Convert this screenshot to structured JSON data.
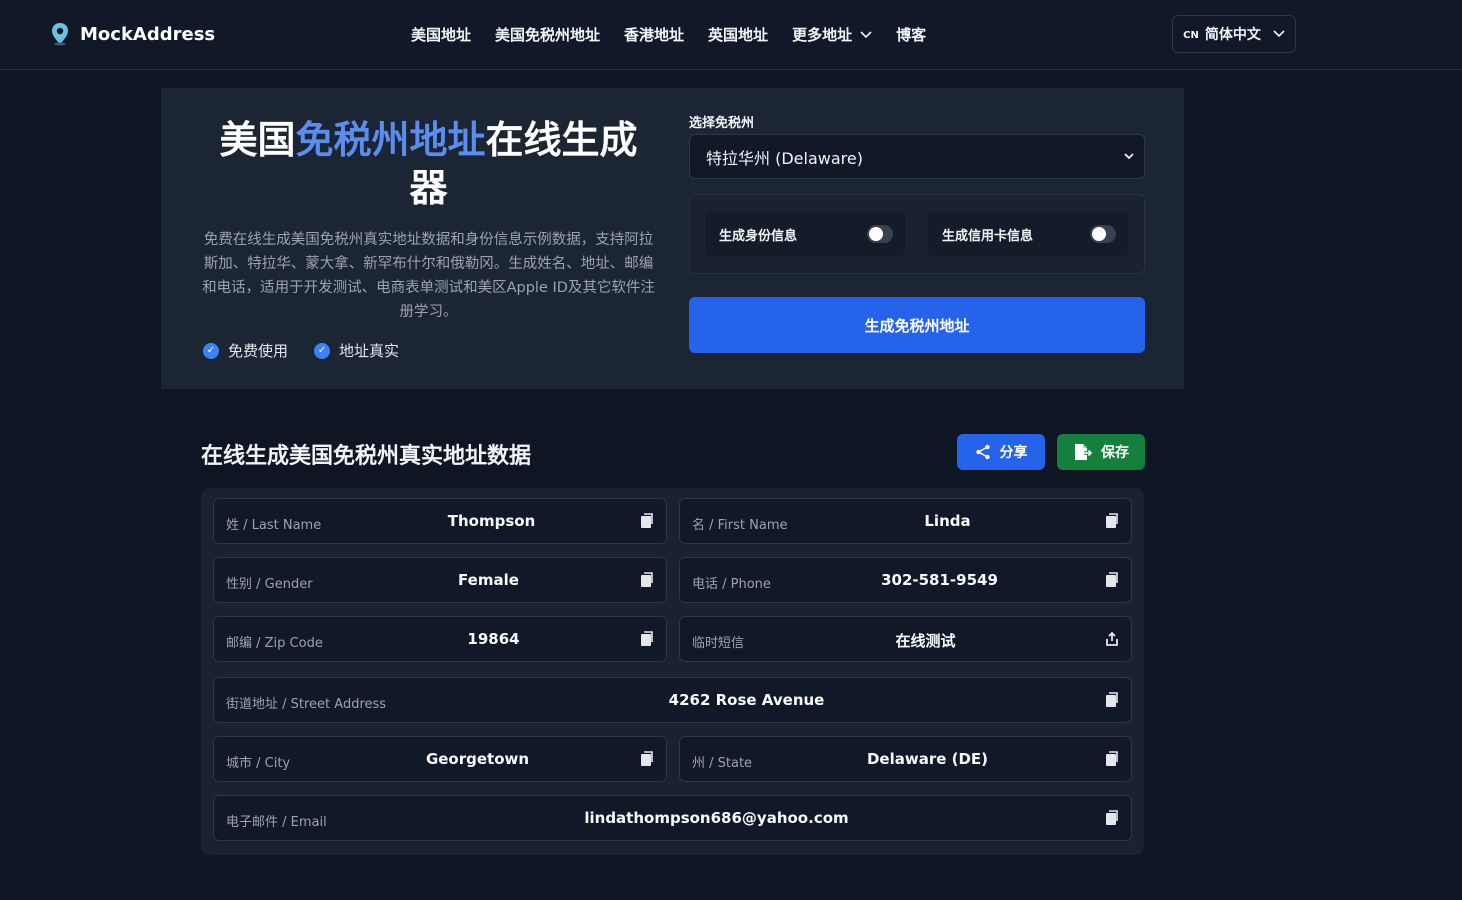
{
  "nav": {
    "brand": "MockAddress",
    "links": [
      "美国地址",
      "美国免税州地址",
      "香港地址",
      "英国地址",
      "更多地址",
      "博客"
    ],
    "lang_code": "CN",
    "lang_label": "简体中文"
  },
  "hero": {
    "title_prefix": "美国",
    "title_accent": "免税州地址",
    "title_suffix": "在线生成器",
    "description": "免费在线生成美国免税州真实地址数据和身份信息示例数据，支持阿拉斯加、特拉华、蒙大拿、新罕布什尔和俄勒冈。生成姓名、地址、邮编和电话，适用于开发测试、电商表单测试和美区Apple ID及其它软件注册学习。",
    "features": [
      "免费使用",
      "地址真实"
    ]
  },
  "form": {
    "select_label": "选择免税州",
    "selected_state": "特拉华州 (Delaware)",
    "toggle_identity": "生成身份信息",
    "toggle_card": "生成信用卡信息",
    "generate_button": "生成免税州地址"
  },
  "results": {
    "title": "在线生成美国免税州真实地址数据",
    "share_label": "分享",
    "save_label": "保存",
    "last_name_label": "姓 / Last Name",
    "last_name": "Thompson",
    "first_name_label": "名 / First Name",
    "first_name": "Linda",
    "gender_label": "性别 / Gender",
    "gender": "Female",
    "phone_label": "电话 / Phone",
    "phone": "302-581-9549",
    "zip_label": "邮编 / Zip Code",
    "zip": "19864",
    "sms_label": "临时短信",
    "sms": "在线测试",
    "street_label": "街道地址 / Street Address",
    "street": "4262 Rose Avenue",
    "city_label": "城市 / City",
    "city": "Georgetown",
    "state_label": "州 / State",
    "state": "Delaware (DE)",
    "email_label": "电子邮件 / Email",
    "email": "lindathompson686@yahoo.com"
  },
  "colors": {
    "background": "#0f1623",
    "accent": "#2563eb",
    "save_green": "#15803d",
    "title_accent": "#5b8def"
  }
}
